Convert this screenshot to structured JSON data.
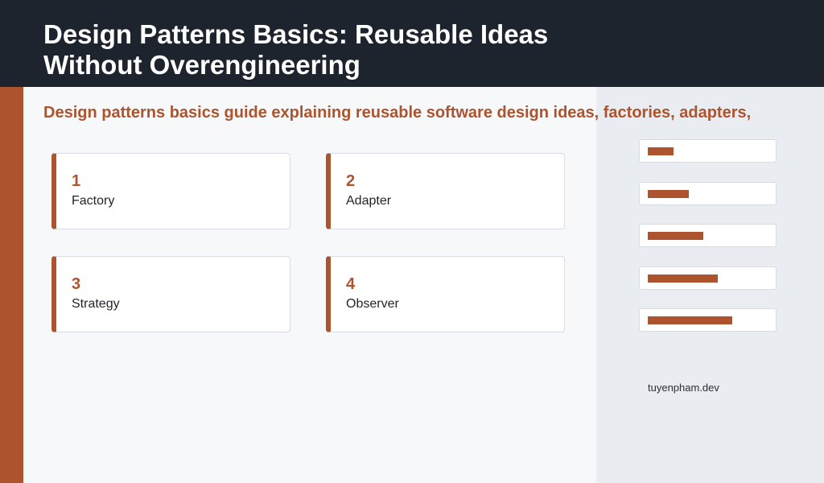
{
  "header": {
    "title": "Design Patterns Basics: Reusable Ideas Without Overengineering"
  },
  "subtitle": "Design patterns basics guide explaining reusable software design ideas, factories, adapters,",
  "cards": [
    {
      "number": "1",
      "label": "Factory"
    },
    {
      "number": "2",
      "label": "Adapter"
    },
    {
      "number": "3",
      "label": "Strategy"
    },
    {
      "number": "4",
      "label": "Observer"
    }
  ],
  "bars": [
    {
      "fraction": 0.21
    },
    {
      "fraction": 0.34
    },
    {
      "fraction": 0.46
    },
    {
      "fraction": 0.58
    },
    {
      "fraction": 0.7
    }
  ],
  "footer": {
    "domain": "tuyenpham.dev"
  },
  "colors": {
    "accent": "#ad532d",
    "header_bg": "#1d242d",
    "page_bg": "#f7f8fa",
    "panel_bg": "#e9edf1"
  }
}
